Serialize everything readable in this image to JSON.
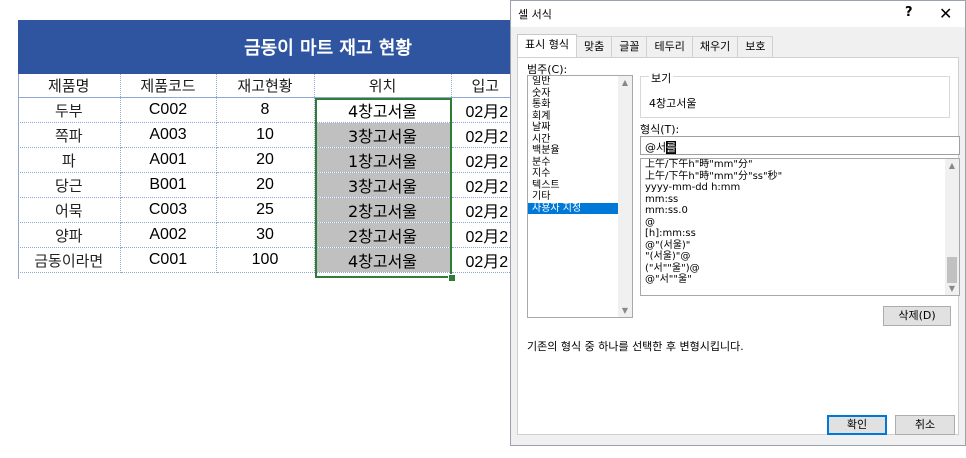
{
  "sheet": {
    "title": "금동이 마트 재고 현황",
    "headers": [
      "제품명",
      "제품코드",
      "재고현황",
      "위치",
      "입고"
    ],
    "rows": [
      {
        "name": "두부",
        "code": "C002",
        "qty": "8",
        "loc": "4창고서울",
        "date": "02月2"
      },
      {
        "name": "쪽파",
        "code": "A003",
        "qty": "10",
        "loc": "3창고서울",
        "date": "02月2"
      },
      {
        "name": "파",
        "code": "A001",
        "qty": "20",
        "loc": "1창고서울",
        "date": "02月2"
      },
      {
        "name": "당근",
        "code": "B001",
        "qty": "20",
        "loc": "3창고서울",
        "date": "02月2"
      },
      {
        "name": "어묵",
        "code": "C003",
        "qty": "25",
        "loc": "2창고서울",
        "date": "02月2"
      },
      {
        "name": "양파",
        "code": "A002",
        "qty": "30",
        "loc": "2창고서울",
        "date": "02月2"
      },
      {
        "name": "금동이라면",
        "code": "C001",
        "qty": "100",
        "loc": "4창고서울",
        "date": "02月2"
      }
    ],
    "colors": {
      "banner": "#2f55a1",
      "selection": "#2f7d32",
      "selected_fill": "#c0c0c0"
    }
  },
  "dialog": {
    "title": "셀 서식",
    "help_label": "?",
    "close_label": "✕",
    "tabs": [
      "표시 형식",
      "맞춤",
      "글꼴",
      "테두리",
      "채우기",
      "보호"
    ],
    "active_tab": "표시 형식",
    "category_label": "범주(C):",
    "categories": [
      "일반",
      "숫자",
      "통화",
      "회계",
      "날짜",
      "시간",
      "백분율",
      "분수",
      "지수",
      "텍스트",
      "기타",
      "사용자 지정"
    ],
    "selected_category": "사용자 지정",
    "preview_label": "보기",
    "preview_value": "4창고서울",
    "format_label": "형식(T):",
    "format_value_prefix": "@서",
    "format_value_cursor": "를",
    "format_list": [
      "上午/下午h\"時\"mm\"分\"",
      "上午/下午h\"時\"mm\"分\"ss\"秒\"",
      "yyyy-mm-dd h:mm",
      "mm:ss",
      "mm:ss.0",
      "@",
      "[h]:mm:ss",
      "@\"(서울)\"",
      "\"(서울)\"@",
      "(\"서\"\"울\")@",
      "@\"서\"\"울\""
    ],
    "delete_button": "삭제(D)",
    "description": "기존의 형식 중 하나를 선택한 후 변형시킵니다.",
    "ok_button": "확인",
    "cancel_button": "취소"
  }
}
